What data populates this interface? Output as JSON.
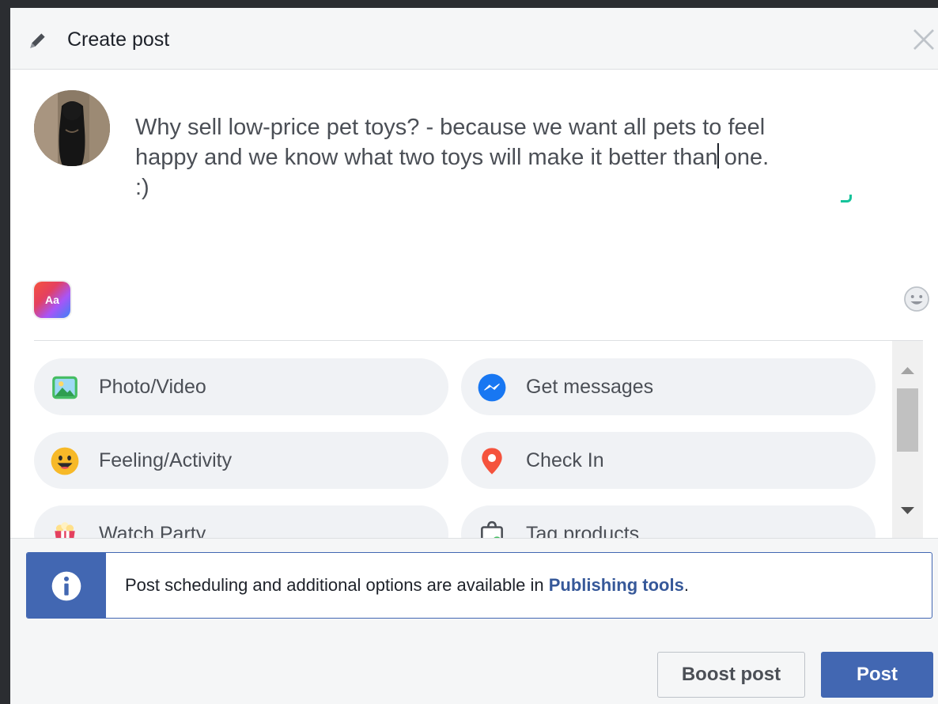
{
  "header": {
    "title": "Create post"
  },
  "composer": {
    "text_before_caret": "Why sell low-price pet toys? - because we want all pets to feel\nhappy and we know what two toys will make it better than",
    "text_after_caret": " one.\n:)"
  },
  "style_button": {
    "label": "Aa"
  },
  "options": [
    {
      "label": "Photo/Video",
      "icon": "photo-video-icon"
    },
    {
      "label": "Get messages",
      "icon": "messenger-icon"
    },
    {
      "label": "Feeling/Activity",
      "icon": "smiley-icon"
    },
    {
      "label": "Check In",
      "icon": "location-pin-icon"
    },
    {
      "label": "Watch Party",
      "icon": "popcorn-icon"
    },
    {
      "label": "Tag products",
      "icon": "shopping-bag-icon"
    }
  ],
  "notice": {
    "text": "Post scheduling and additional options are available in ",
    "link": "Publishing tools",
    "suffix": "."
  },
  "buttons": {
    "boost": "Boost post",
    "post": "Post"
  },
  "colors": {
    "brand": "#4267b2",
    "link": "#365899",
    "panel": "#f5f6f7"
  }
}
